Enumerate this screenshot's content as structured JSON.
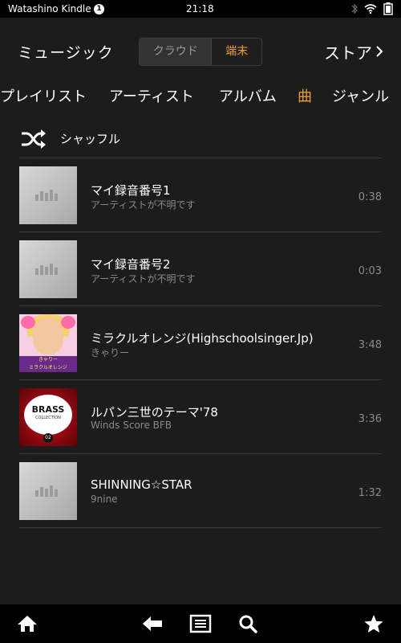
{
  "status_bar": {
    "device_name": "Watashino Kindle",
    "notification_count": "1",
    "time": "21:18",
    "icons": [
      "bluetooth-icon",
      "wifi-icon",
      "battery-icon"
    ]
  },
  "header": {
    "title": "ミュージック",
    "segment": {
      "cloud_label": "クラウド",
      "device_label": "端末",
      "selected": "端末"
    },
    "store_label": "ストア"
  },
  "tabs": [
    {
      "label": "プレイリスト",
      "active": false
    },
    {
      "label": "アーティスト",
      "active": false
    },
    {
      "label": "アルバム",
      "active": false
    },
    {
      "label": "曲",
      "active": true
    },
    {
      "label": "ジャンル",
      "active": false
    }
  ],
  "shuffle": {
    "label": "シャッフル"
  },
  "songs": [
    {
      "title": "マイ録音番号1",
      "artist": "アーティストが不明です",
      "duration": "0:38",
      "art": "placeholder"
    },
    {
      "title": "マイ録音番号2",
      "artist": "アーティストが不明です",
      "duration": "0:03",
      "art": "placeholder"
    },
    {
      "title": "ミラクルオレンジ(Highschoolsinger.Jp)",
      "artist": "きゃりー",
      "duration": "3:48",
      "art": "kyary",
      "art_text": [
        "きゃりー",
        "ミラクルオレンジ"
      ]
    },
    {
      "title": "ルパン三世のテーマ'78",
      "artist": "Winds Score BFB",
      "duration": "3:36",
      "art": "brass",
      "art_text": [
        "BRASS",
        "COLLECTION",
        "02"
      ]
    },
    {
      "title": "SHINNING☆STAR",
      "artist": "9nine",
      "duration": "1:32",
      "art": "placeholder"
    }
  ],
  "bottom_nav": [
    "home-icon",
    "back-icon",
    "menu-icon",
    "search-icon",
    "favorites-icon"
  ],
  "colors": {
    "accent": "#f0a030",
    "background": "#1c1c1c",
    "secondary_text": "#8a8a8a"
  }
}
